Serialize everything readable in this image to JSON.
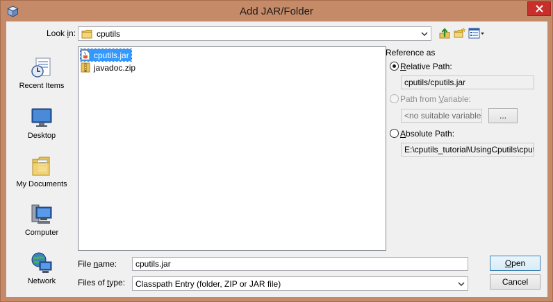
{
  "window": {
    "title": "Add JAR/Folder"
  },
  "look_in": {
    "label_pre": "Look ",
    "label_key": "i",
    "label_post": "n:",
    "value": "cputils"
  },
  "places": [
    {
      "label": "Recent Items",
      "icon": "recent-items-icon"
    },
    {
      "label": "Desktop",
      "icon": "desktop-icon"
    },
    {
      "label": "My Documents",
      "icon": "my-documents-icon"
    },
    {
      "label": "Computer",
      "icon": "computer-icon"
    },
    {
      "label": "Network",
      "icon": "network-icon"
    }
  ],
  "files": [
    {
      "name": "cputils.jar",
      "icon": "jar-file-icon",
      "selected": true
    },
    {
      "name": "javadoc.zip",
      "icon": "zip-file-icon",
      "selected": false
    }
  ],
  "reference": {
    "heading": "Reference as",
    "relative": {
      "label_key": "R",
      "label_rest": "elative Path:",
      "value": "cputils/cputils.jar",
      "checked": true
    },
    "variable": {
      "label_pre": "Path from ",
      "label_key": "V",
      "label_rest": "ariable:",
      "value": "<no suitable variable>",
      "browse": "...",
      "enabled": false
    },
    "absolute": {
      "label_key": "A",
      "label_rest": "bsolute Path:",
      "value": "E:\\cputils_tutorial\\UsingCputils\\cputils\\cputils.jar",
      "checked": false
    }
  },
  "file_name": {
    "label_pre": "File ",
    "label_key": "n",
    "label_post": "ame:",
    "value": "cputils.jar"
  },
  "file_type": {
    "label_pre": "Files of ",
    "label_key": "t",
    "label_post": "ype:",
    "value": "Classpath Entry (folder, ZIP or JAR file)"
  },
  "buttons": {
    "open": "Open",
    "open_key": "O",
    "open_rest": "pen",
    "cancel": "Cancel"
  },
  "colors": {
    "titlebar": "#c58a68",
    "selection": "#3399ff",
    "close": "#c7302a"
  }
}
